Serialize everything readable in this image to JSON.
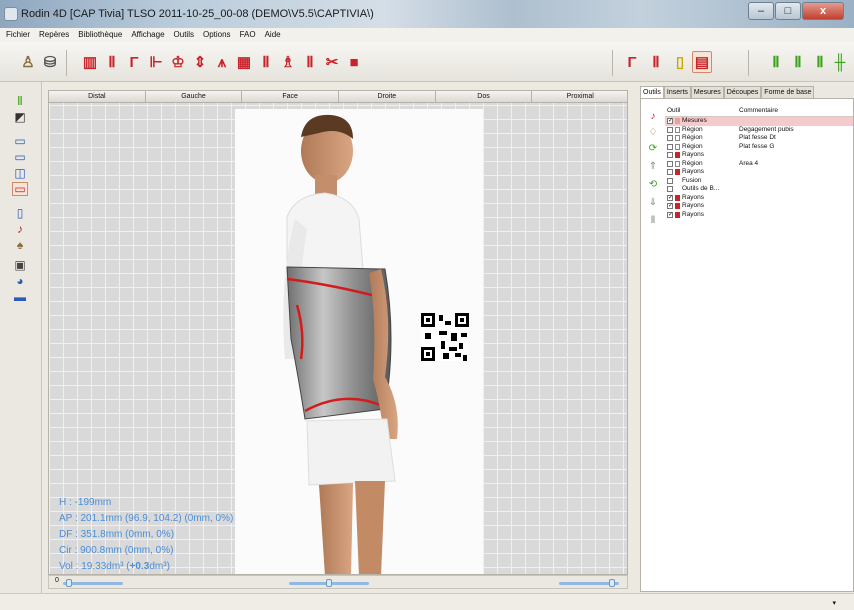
{
  "window": {
    "title": "Rodin 4D [CAP Tivia] TLSO 2011-10-25_00-08 (DEMO\\V5.5\\CAPTIVIA\\)",
    "min": "–",
    "max": "□",
    "close": "x"
  },
  "menu": [
    "Fichier",
    "Repères",
    "Bibliothèque",
    "Affichage",
    "Outils",
    "Options",
    "FAO",
    "Aide"
  ],
  "view_tabs": [
    "Distal",
    "Gauche",
    "Face",
    "Droite",
    "Dos",
    "Proximal"
  ],
  "measurements": {
    "h": "H : -199mm",
    "ap": "AP : 201.1mm (96.9, 104.2) (0mm, 0%)",
    "df": "DF : 351.8mm (0mm, 0%)",
    "cir": "Cir : 900.8mm (0mm, 0%)",
    "vol_prefix": "Vol : 19.33dm³ (",
    "vol_delta": "+0.3",
    "vol_suffix": "dm³)"
  },
  "zoom_label": "0",
  "sliders": [
    0.1,
    0.5,
    0.88
  ],
  "right_tabs": [
    "Outils",
    "Inserts",
    "Mesures",
    "Découpes",
    "Forme de base"
  ],
  "active_right_tab": "Outils",
  "table": {
    "headers": [
      "Outil",
      "Commentaire"
    ],
    "rows": [
      {
        "checked": true,
        "icon": "measure",
        "outil": "Mesures",
        "comment": "",
        "highlight": true
      },
      {
        "checked": false,
        "icon": "region",
        "outil": "Région",
        "comment": "Degagement pubis"
      },
      {
        "checked": false,
        "icon": "region",
        "outil": "Région",
        "comment": "Plat fesse Dt"
      },
      {
        "checked": false,
        "icon": "region",
        "outil": "Région",
        "comment": "Plat fesse G"
      },
      {
        "checked": false,
        "icon": "rayons",
        "outil": "Rayons",
        "comment": ""
      },
      {
        "checked": false,
        "icon": "region",
        "outil": "Région",
        "comment": "Area 4"
      },
      {
        "checked": false,
        "icon": "rayons",
        "outil": "Rayons",
        "comment": ""
      },
      {
        "checked": false,
        "icon": "none",
        "outil": "Fusion",
        "comment": ""
      },
      {
        "checked": false,
        "icon": "none",
        "outil": "Outils de B...",
        "comment": ""
      },
      {
        "checked": true,
        "icon": "rayons",
        "outil": "Rayons",
        "comment": ""
      },
      {
        "checked": true,
        "icon": "rayons",
        "outil": "Rayons",
        "comment": ""
      },
      {
        "checked": true,
        "icon": "rayons",
        "outil": "Rayons",
        "comment": ""
      }
    ]
  },
  "colors": {
    "accent_red": "#c8242b",
    "measure_blue": "#4b8ed8",
    "highlight_row": "#f6c9cc"
  }
}
